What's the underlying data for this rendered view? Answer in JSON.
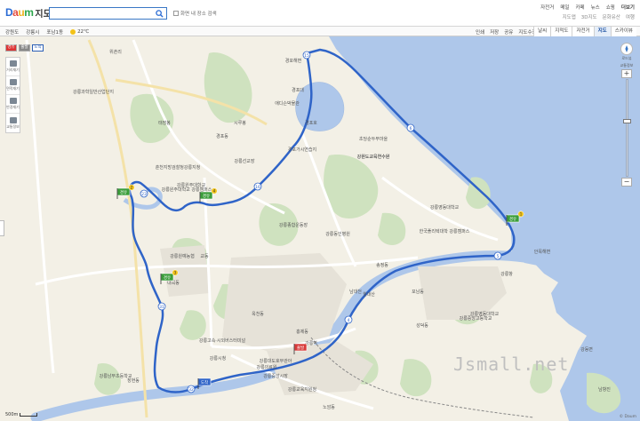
{
  "header": {
    "logo_brand": "Daum",
    "logo_service": "지도",
    "search_value": "",
    "search_placeholder": "",
    "area_search_label": "화면 내 장소 검색",
    "top_links": [
      "자전거",
      "메일",
      "카페",
      "뉴스",
      "쇼핑",
      "더보기"
    ],
    "sub_links": [
      "지도앱",
      "3D지도",
      "문화유산",
      "여행"
    ]
  },
  "location_bar": {
    "province": "강원도",
    "city": "강릉시",
    "district": "포남1동",
    "temperature": "22℃"
  },
  "map_tools": [
    "인쇄",
    "저장",
    "공유",
    "지도수정"
  ],
  "map_types": [
    "날씨",
    "지적도",
    "자전거",
    "지도",
    "스카이뷰"
  ],
  "active_map_type": "지도",
  "left_tabs": [
    "경유",
    "출발",
    "도착"
  ],
  "left_tools": [
    "거리재기",
    "면적재기",
    "반경재기",
    "교통정보"
  ],
  "zoom": {
    "labels": [
      "로드뷰",
      "교통정보"
    ],
    "plus": "+",
    "minus": "−",
    "level_fraction": 0.42
  },
  "scale_label": "500m",
  "watermark": "Jsmall.net",
  "copyright": "© Daum",
  "colors": {
    "sea": "#aec7ea",
    "land": "#f3f0e6",
    "park": "#cfe2bf",
    "route": "#2f64c8",
    "river": "#aec7ea"
  },
  "markers": [
    {
      "label": "경유",
      "num": "1"
    },
    {
      "label": "경유",
      "num": "2"
    },
    {
      "label": "경유",
      "num": "3"
    },
    {
      "label": "경유",
      "num": "4"
    },
    {
      "label": "출발",
      "num": ""
    },
    {
      "label": "도착",
      "num": ""
    }
  ],
  "place_labels": [
    "강릉과학일반산업단지",
    "경포해변",
    "경포대",
    "시루봉",
    "태장봉",
    "애디슨박물관",
    "경포호",
    "경포가시연습지",
    "초당순두부마을",
    "경포동",
    "강원도교육연수원",
    "춘천지방검찰청강릉지청",
    "강릉선교장",
    "강릉원주대학교",
    "강릉원주대학교 강릉캠퍼스",
    "강릉종합운동장",
    "강릉동인병원",
    "강원도교육연수원",
    "강릉영동대학교",
    "교동",
    "송정동",
    "강릉항",
    "안목해변",
    "한국폴리텍대학 강릉캠퍼스",
    "강릉중앙고등학교",
    "남대천",
    "강릉시청",
    "강릉고속·시외버스터미널",
    "강릉의료원",
    "옥천동",
    "강릉역",
    "성덕동",
    "강릉중앙시장",
    "강릉남부초등학교",
    "강동면",
    "강릉교육지원청",
    "남항진",
    "포남동",
    "월대산",
    "강릉대도호부관아",
    "홍제동",
    "위촌리",
    "강릉원예농협",
    "내곡동",
    "장현동",
    "강릉영동대학교",
    "노암동"
  ]
}
